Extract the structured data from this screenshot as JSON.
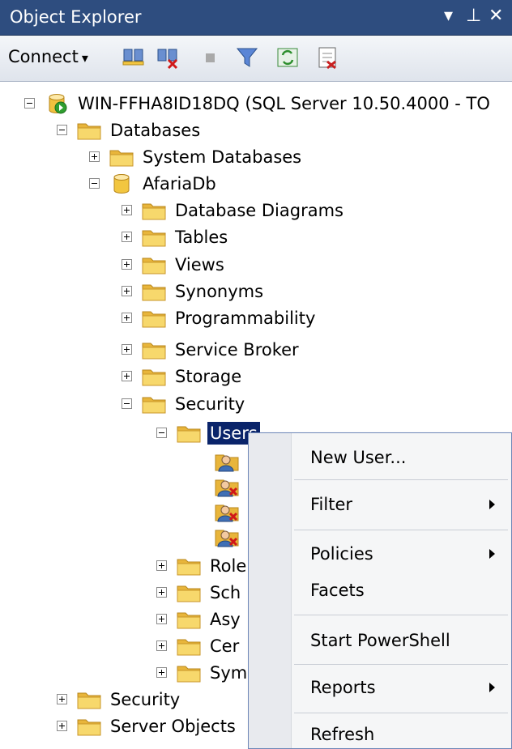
{
  "window": {
    "title": "Object Explorer",
    "pin_glyph": "⊥",
    "close_glyph": "✕",
    "dropdown_glyph": "▾"
  },
  "toolbar": {
    "connect_label": "Connect",
    "connect_arrow": "▾"
  },
  "tree": {
    "server": "WIN-FFHA8ID18DQ (SQL Server 10.50.4000 - TO",
    "databases": "Databases",
    "system_databases": "System Databases",
    "afariadb": "AfariaDb",
    "database_diagrams": "Database Diagrams",
    "tables": "Tables",
    "views": "Views",
    "synonyms": "Synonyms",
    "programmability": "Programmability",
    "service_broker": "Service Broker",
    "storage": "Storage",
    "security_db": "Security",
    "users": "Users",
    "roles": "Role",
    "schemas": "Sch",
    "asymmetric_keys": "Asy",
    "certificates": "Cer",
    "symmetric_keys": "Sym",
    "security_server": "Security",
    "server_objects": "Server Objects"
  },
  "context_menu": {
    "new_user": "New User...",
    "filter": "Filter",
    "policies": "Policies",
    "facets": "Facets",
    "start_powershell": "Start PowerShell",
    "reports": "Reports",
    "refresh": "Refresh"
  },
  "colors": {
    "titlebar": "#2e4d7f",
    "selection": "#0a246a",
    "folder": "#f5cf5e",
    "menu_border": "#6e87b8"
  }
}
